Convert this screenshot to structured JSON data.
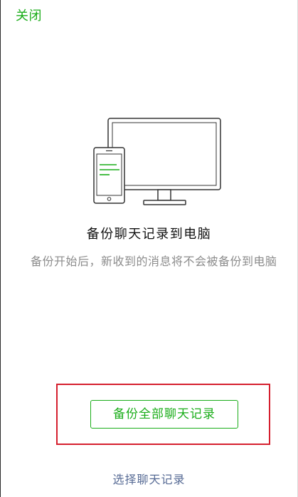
{
  "header": {
    "close_label": "关闭"
  },
  "illustration": {
    "icon": "phone-to-computer-icon"
  },
  "content": {
    "title": "备份聊天记录到电脑",
    "description": "备份开始后，新收到的消息将不会被备份到电脑"
  },
  "actions": {
    "backup_all_label": "备份全部聊天记录",
    "select_label": "选择聊天记录"
  },
  "colors": {
    "accent": "#1aad19",
    "link": "#576b95",
    "highlight": "#d51f2e"
  }
}
